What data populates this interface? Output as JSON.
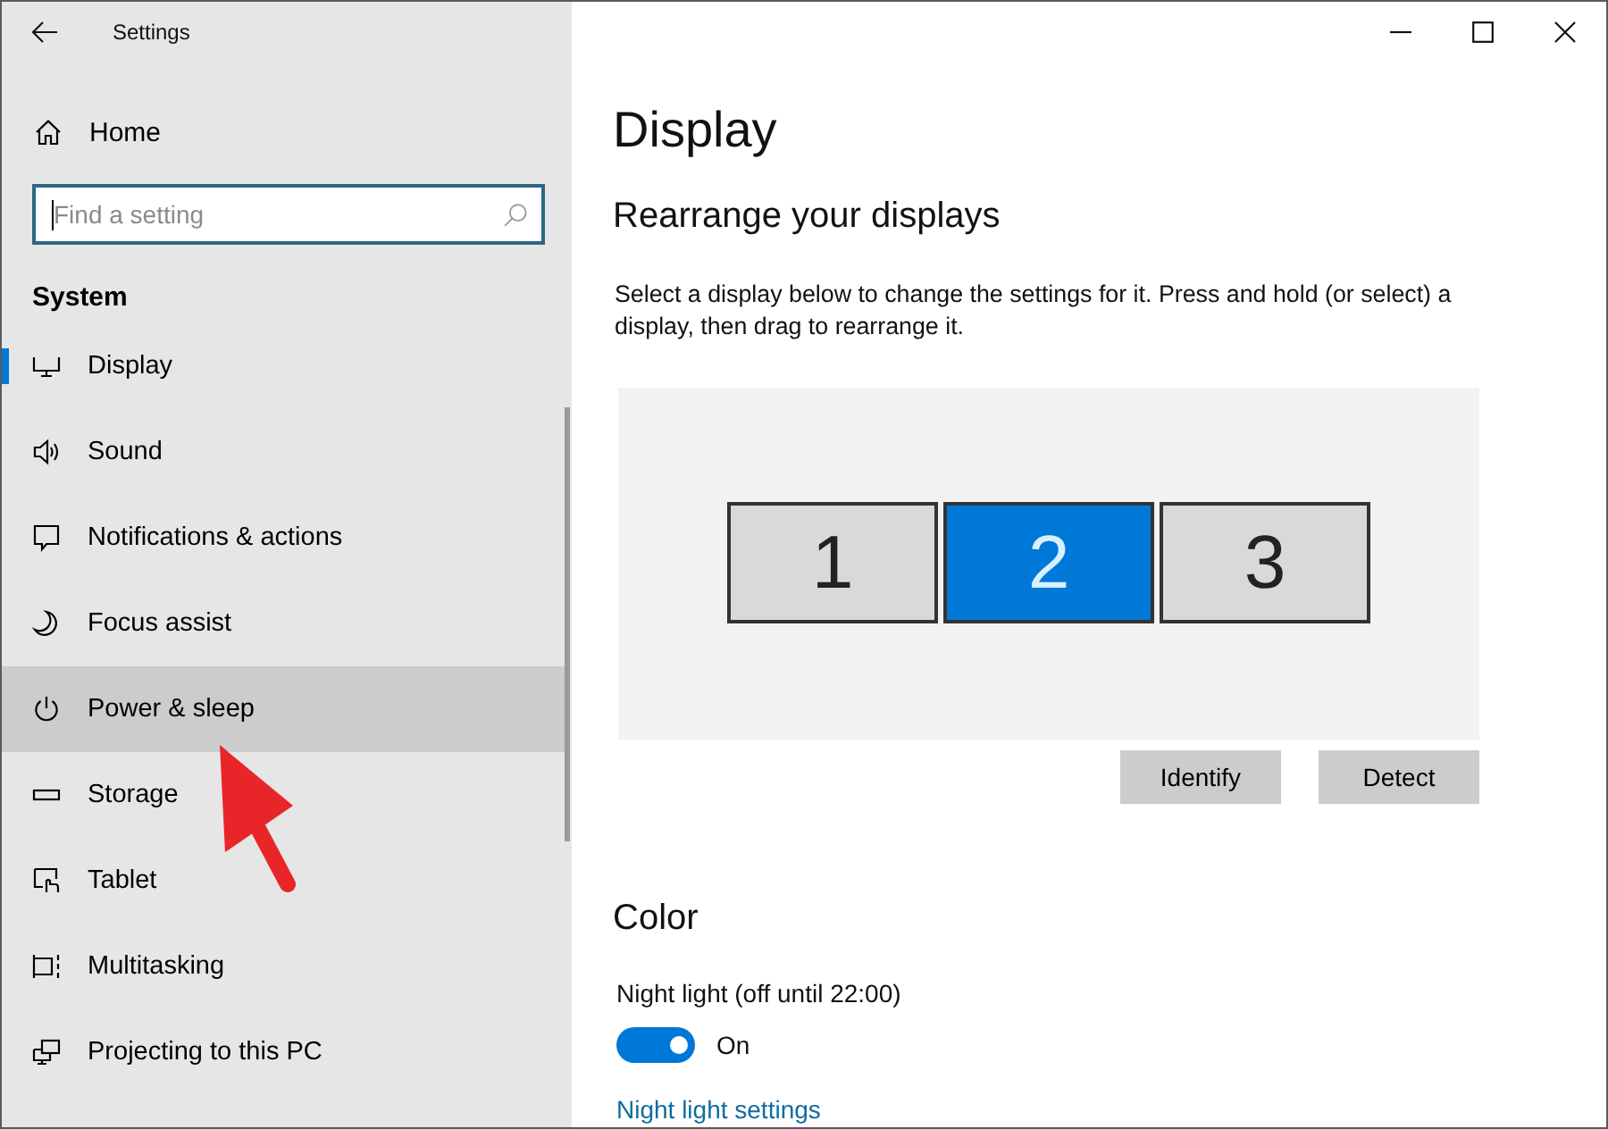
{
  "window": {
    "title": "Settings",
    "controls": [
      {
        "kind": "minimize"
      },
      {
        "kind": "maximize"
      },
      {
        "kind": "close"
      }
    ]
  },
  "sidebar": {
    "home": "Home",
    "search": {
      "placeholder": "Find a setting"
    },
    "section": "System",
    "items": [
      {
        "label": "Display",
        "kind": "display",
        "selected": true,
        "highlighted": false
      },
      {
        "label": "Sound",
        "kind": "sound",
        "selected": false,
        "highlighted": false
      },
      {
        "label": "Notifications & actions",
        "kind": "notifications",
        "selected": false,
        "highlighted": false
      },
      {
        "label": "Focus assist",
        "kind": "focus",
        "selected": false,
        "highlighted": false
      },
      {
        "label": "Power & sleep",
        "kind": "power",
        "selected": false,
        "highlighted": true
      },
      {
        "label": "Storage",
        "kind": "storage",
        "selected": false,
        "highlighted": false
      },
      {
        "label": "Tablet",
        "kind": "tablet",
        "selected": false,
        "highlighted": false
      },
      {
        "label": "Multitasking",
        "kind": "multitasking",
        "selected": false,
        "highlighted": false
      },
      {
        "label": "Projecting to this PC",
        "kind": "projecting",
        "selected": false,
        "highlighted": false
      }
    ]
  },
  "page": {
    "title": "Display",
    "arrange": {
      "heading": "Rearrange your displays",
      "description": "Select a display below to change the settings for it. Press and hold (or select) a display, then drag to rearrange it.",
      "monitors": [
        {
          "label": "1",
          "selected": false
        },
        {
          "label": "2",
          "selected": true
        },
        {
          "label": "3",
          "selected": false
        }
      ],
      "buttons": [
        "Identify",
        "Detect"
      ]
    },
    "color": {
      "heading": "Color",
      "night_light": {
        "label": "Night light (off until 22:00)",
        "on": true,
        "state_label": "On",
        "link": "Night light settings"
      }
    }
  }
}
